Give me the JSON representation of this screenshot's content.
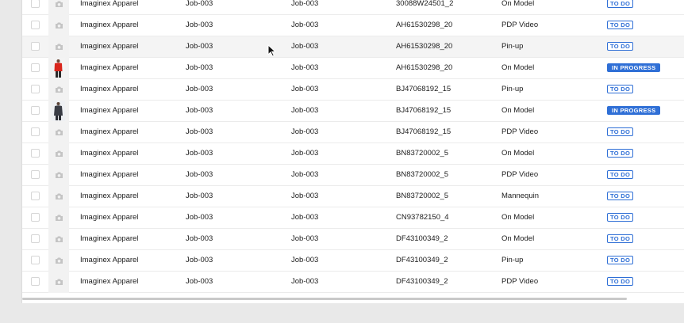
{
  "rows": [
    {
      "client": "Imaginex Apparel",
      "job": "Job-003",
      "job_ref": "Job-003",
      "sku": "30088W24501_2",
      "shot": "On Model",
      "status": "TO DO",
      "status_type": "todo",
      "thumb": "camera-icon"
    },
    {
      "client": "Imaginex Apparel",
      "job": "Job-003",
      "job_ref": "Job-003",
      "sku": "AH61530298_20",
      "shot": "PDP Video",
      "status": "TO DO",
      "status_type": "todo",
      "thumb": "camera-icon"
    },
    {
      "client": "Imaginex Apparel",
      "job": "Job-003",
      "job_ref": "Job-003",
      "sku": "AH61530298_20",
      "shot": "Pin-up",
      "status": "TO DO",
      "status_type": "todo",
      "thumb": "camera-icon",
      "hover": true
    },
    {
      "client": "Imaginex Apparel",
      "job": "Job-003",
      "job_ref": "Job-003",
      "sku": "AH61530298_20",
      "shot": "On Model",
      "status": "IN PROGRESS",
      "status_type": "progress",
      "thumb": "photo-red"
    },
    {
      "client": "Imaginex Apparel",
      "job": "Job-003",
      "job_ref": "Job-003",
      "sku": "BJ47068192_15",
      "shot": "Pin-up",
      "status": "TO DO",
      "status_type": "todo",
      "thumb": "camera-icon"
    },
    {
      "client": "Imaginex Apparel",
      "job": "Job-003",
      "job_ref": "Job-003",
      "sku": "BJ47068192_15",
      "shot": "On Model",
      "status": "IN PROGRESS",
      "status_type": "progress",
      "thumb": "photo-dark"
    },
    {
      "client": "Imaginex Apparel",
      "job": "Job-003",
      "job_ref": "Job-003",
      "sku": "BJ47068192_15",
      "shot": "PDP Video",
      "status": "TO DO",
      "status_type": "todo",
      "thumb": "camera-icon"
    },
    {
      "client": "Imaginex Apparel",
      "job": "Job-003",
      "job_ref": "Job-003",
      "sku": "BN83720002_5",
      "shot": "On Model",
      "status": "TO DO",
      "status_type": "todo",
      "thumb": "camera-icon"
    },
    {
      "client": "Imaginex Apparel",
      "job": "Job-003",
      "job_ref": "Job-003",
      "sku": "BN83720002_5",
      "shot": "PDP Video",
      "status": "TO DO",
      "status_type": "todo",
      "thumb": "camera-icon"
    },
    {
      "client": "Imaginex Apparel",
      "job": "Job-003",
      "job_ref": "Job-003",
      "sku": "BN83720002_5",
      "shot": "Mannequin",
      "status": "TO DO",
      "status_type": "todo",
      "thumb": "camera-icon"
    },
    {
      "client": "Imaginex Apparel",
      "job": "Job-003",
      "job_ref": "Job-003",
      "sku": "CN93782150_4",
      "shot": "On Model",
      "status": "TO DO",
      "status_type": "todo",
      "thumb": "camera-icon"
    },
    {
      "client": "Imaginex Apparel",
      "job": "Job-003",
      "job_ref": "Job-003",
      "sku": "DF43100349_2",
      "shot": "On Model",
      "status": "TO DO",
      "status_type": "todo",
      "thumb": "camera-icon"
    },
    {
      "client": "Imaginex Apparel",
      "job": "Job-003",
      "job_ref": "Job-003",
      "sku": "DF43100349_2",
      "shot": "Pin-up",
      "status": "TO DO",
      "status_type": "todo",
      "thumb": "camera-icon"
    },
    {
      "client": "Imaginex Apparel",
      "job": "Job-003",
      "job_ref": "Job-003",
      "sku": "DF43100349_2",
      "shot": "PDP Video",
      "status": "TO DO",
      "status_type": "todo",
      "thumb": "camera-icon"
    }
  ],
  "colors": {
    "accent": "#2f6fd6",
    "row_hover": "#f4f4f4",
    "border": "#ebebeb"
  }
}
